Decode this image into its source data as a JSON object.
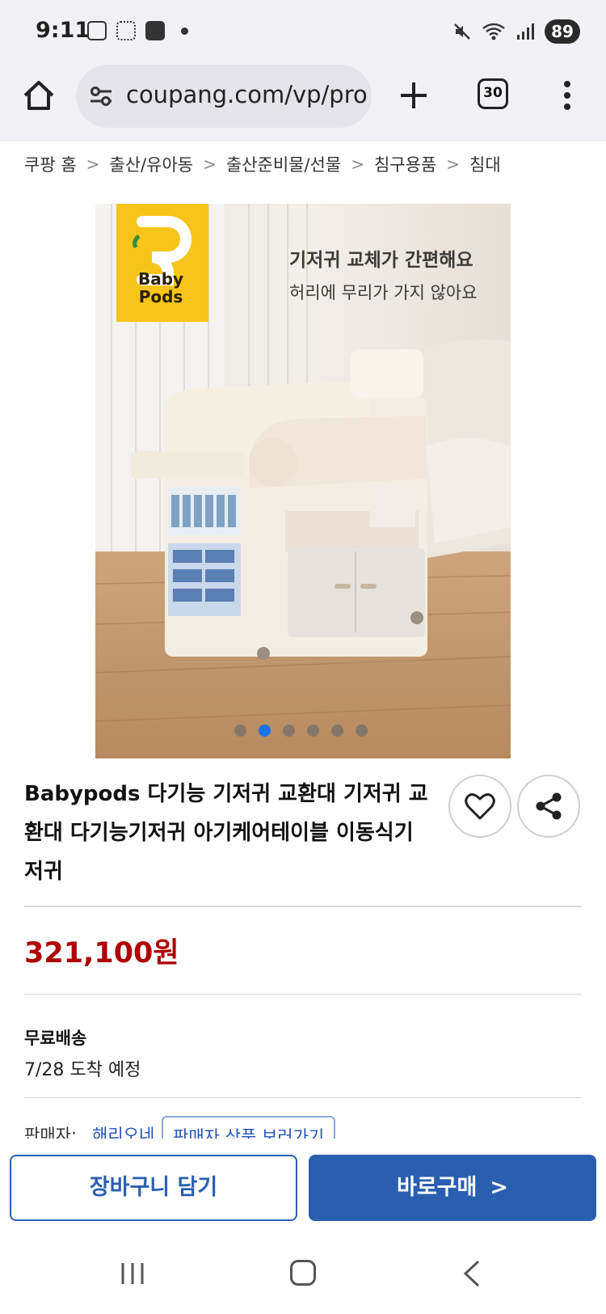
{
  "status_bar": {
    "time": "9:11",
    "battery": "89"
  },
  "browser": {
    "url": "coupang.com/vp/pro",
    "tab_count": "30"
  },
  "breadcrumb": [
    "쿠팡 홈",
    "출산/유아동",
    "출산준비물/선물",
    "침구용품",
    "침대"
  ],
  "product_image": {
    "headline": "기저귀 교체가 간편해요",
    "subline": "허리에 무리가 가지 않아요",
    "logo_text": "Baby Pods",
    "pager_count": 6,
    "pager_active_index": 1
  },
  "product": {
    "title": "Babypods 다기능 기저귀 교환대 기저귀 교환대 다기능기저귀 아기케어테이블 이동식기저귀",
    "price": "321,100원",
    "shipping_label": "무료배송",
    "shipping_date": "7/28 도착 예정",
    "seller_label": "판매자:",
    "seller_name": "해리오네",
    "seller_more": "판매자 상품 보러가기"
  },
  "actions": {
    "cart_label": "장바구니 담기",
    "buy_label": "바로구매"
  },
  "colors": {
    "accent": "#2a5fb0",
    "price": "#ae0000",
    "pager_active": "#1874e8",
    "logo_yellow": "#f7c51a"
  }
}
